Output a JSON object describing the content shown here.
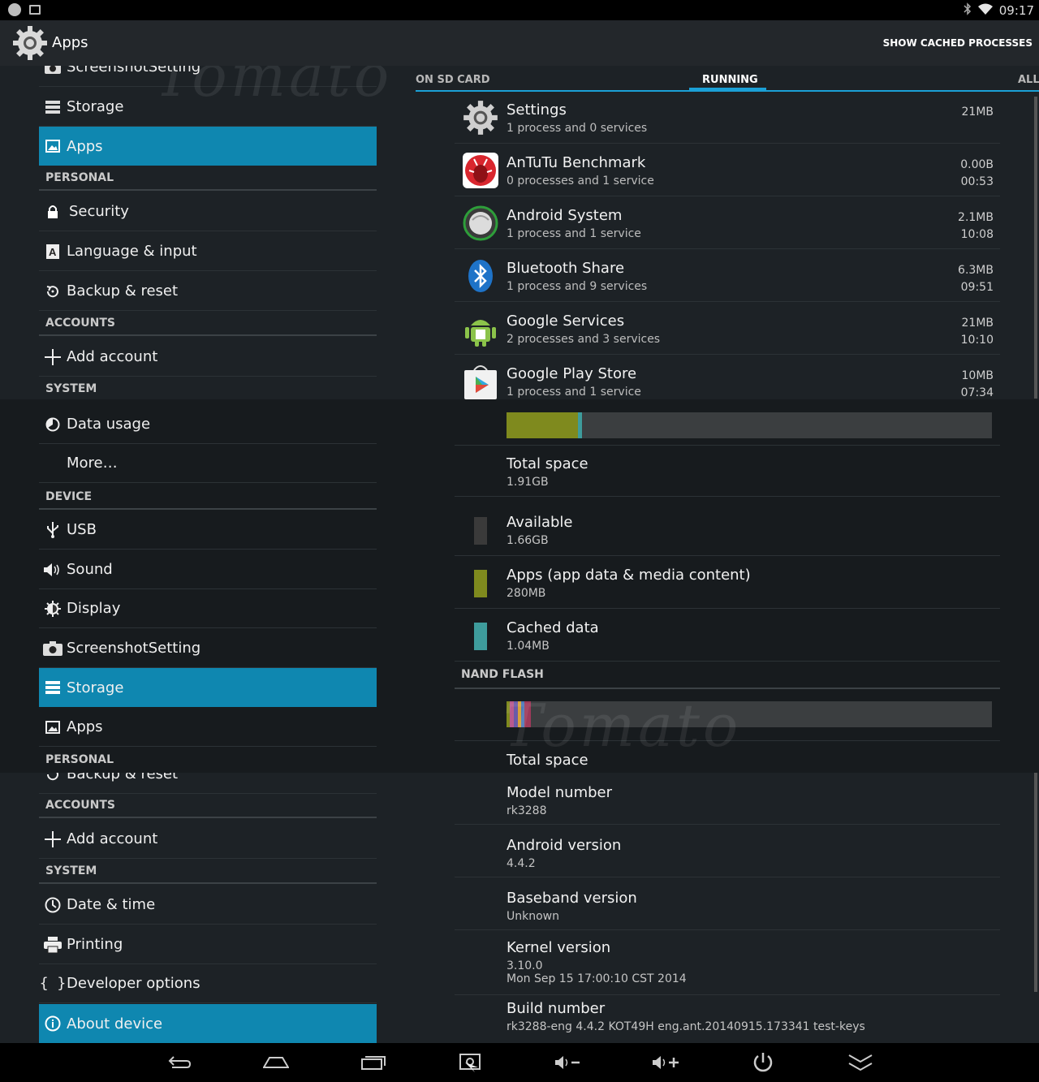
{
  "statusbar": {
    "time": "09:17"
  },
  "actionbar": {
    "title": "Apps",
    "action": "SHOW CACHED PROCESSES"
  },
  "panel1": {
    "left": {
      "partial_top": "ScreenshotSetting",
      "storage": "Storage",
      "apps": "Apps",
      "personal": "PERSONAL",
      "security": "Security",
      "language": "Language & input",
      "backup": "Backup & reset",
      "accounts": "ACCOUNTS",
      "add_account": "Add account",
      "system": "SYSTEM"
    },
    "tabs": [
      "ON SD CARD",
      "RUNNING",
      "ALL"
    ],
    "running": [
      {
        "name": "Settings",
        "sub": "1 process and 0 services",
        "size": "21MB",
        "time": ""
      },
      {
        "name": "AnTuTu Benchmark",
        "sub": "0 processes and 1 service",
        "size": "0.00B",
        "time": "00:53"
      },
      {
        "name": "Android System",
        "sub": "1 process and 1 service",
        "size": "2.1MB",
        "time": "10:08"
      },
      {
        "name": "Bluetooth Share",
        "sub": "1 process and 9 services",
        "size": "6.3MB",
        "time": "09:51"
      },
      {
        "name": "Google Services",
        "sub": "2 processes and 3 services",
        "size": "21MB",
        "time": "10:10"
      },
      {
        "name": "Google Play Store",
        "sub": "1 process and 1 service",
        "size": "10MB",
        "time": "07:34"
      }
    ]
  },
  "panel2": {
    "left": {
      "data_usage": "Data usage",
      "more": "More…",
      "device": "DEVICE",
      "usb": "USB",
      "sound": "Sound",
      "display": "Display",
      "screenshot": "ScreenshotSetting",
      "storage": "Storage",
      "apps": "Apps",
      "personal": "PERSONAL"
    },
    "sd_usage": {
      "apps_fraction": 0.147,
      "cached_fraction": 0.008
    },
    "storage_rows": [
      {
        "name": "Total space",
        "value": "1.91GB",
        "color": ""
      },
      {
        "name": "Available",
        "value": "1.66GB",
        "color": "#3a3a3a"
      },
      {
        "name": "Apps (app data & media content)",
        "value": "280MB",
        "color": "#7f8a1e"
      },
      {
        "name": "Cached data",
        "value": "1.04MB",
        "color": "#3e9c9c"
      }
    ],
    "nand_header": "NAND FLASH",
    "nand_total": "Total space"
  },
  "panel3": {
    "left": {
      "partial_top": "Backup & reset",
      "accounts": "ACCOUNTS",
      "add_account": "Add account",
      "system": "SYSTEM",
      "date_time": "Date & time",
      "printing": "Printing",
      "developer": "Developer options",
      "about": "About device"
    },
    "about_rows": [
      {
        "name": "Model number",
        "value": "rk3288",
        "value2": ""
      },
      {
        "name": "Android version",
        "value": "4.4.2",
        "value2": ""
      },
      {
        "name": "Baseband version",
        "value": "Unknown",
        "value2": ""
      },
      {
        "name": "Kernel version",
        "value": "3.10.0",
        "value2": "Mon Sep 15 17:00:10 CST 2014"
      },
      {
        "name": "Build number",
        "value": "rk3288-eng 4.4.2 KOT49H eng.ant.20140915.173341 test-keys",
        "value2": ""
      }
    ]
  },
  "watermark": "Tomato",
  "colors": {
    "accent": "#0f87b0",
    "tab_indicator": "#1ba0d6"
  }
}
